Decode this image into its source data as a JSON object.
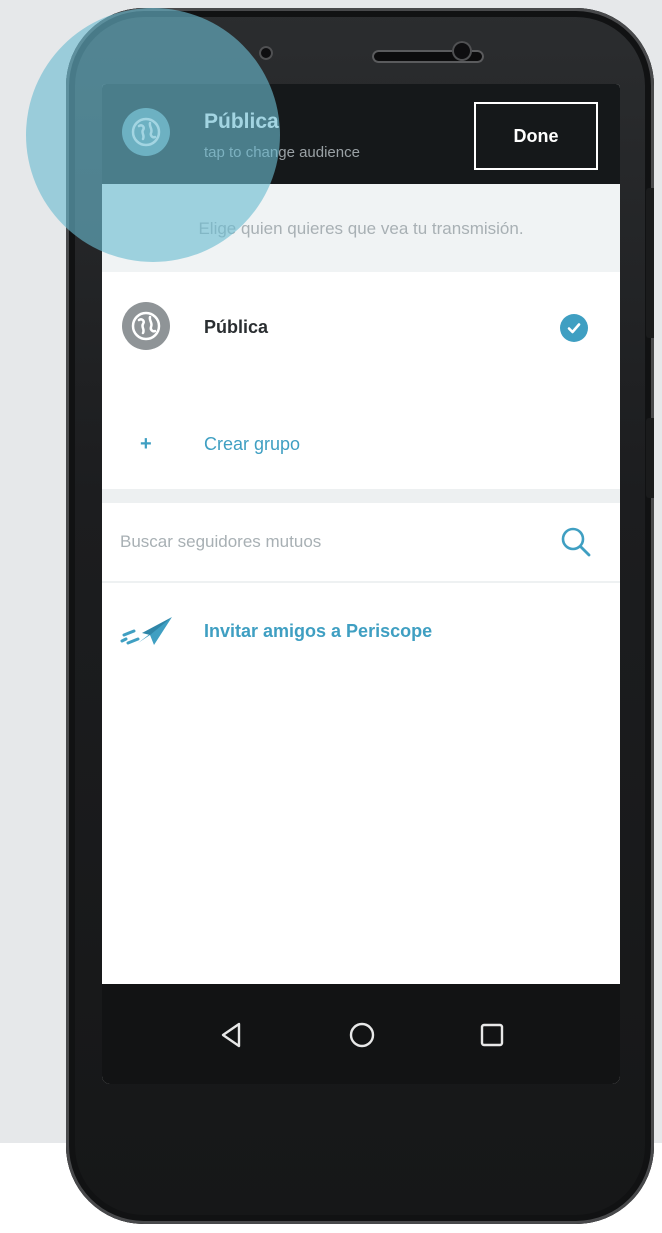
{
  "header": {
    "title": "Pública",
    "subtitle": "tap to change audience",
    "done_label": "Done"
  },
  "hint": "Elige quien quieres que vea tu transmisión.",
  "audience": {
    "label": "Pública",
    "selected": true
  },
  "create_group_label": "Crear grupo",
  "search": {
    "placeholder": "Buscar seguidores mutuos"
  },
  "invite_label": "Invitar amigos a Periscope",
  "colors": {
    "accent": "#3f9fc2",
    "header_bg": "#15181a",
    "highlight": "#6abcd1"
  },
  "icons": {
    "globe": "globe-icon",
    "check": "check-icon",
    "plus": "plus-icon",
    "search": "search-icon",
    "plane": "paper-plane-icon",
    "back": "back-icon",
    "home": "home-icon",
    "recents": "recents-icon"
  }
}
